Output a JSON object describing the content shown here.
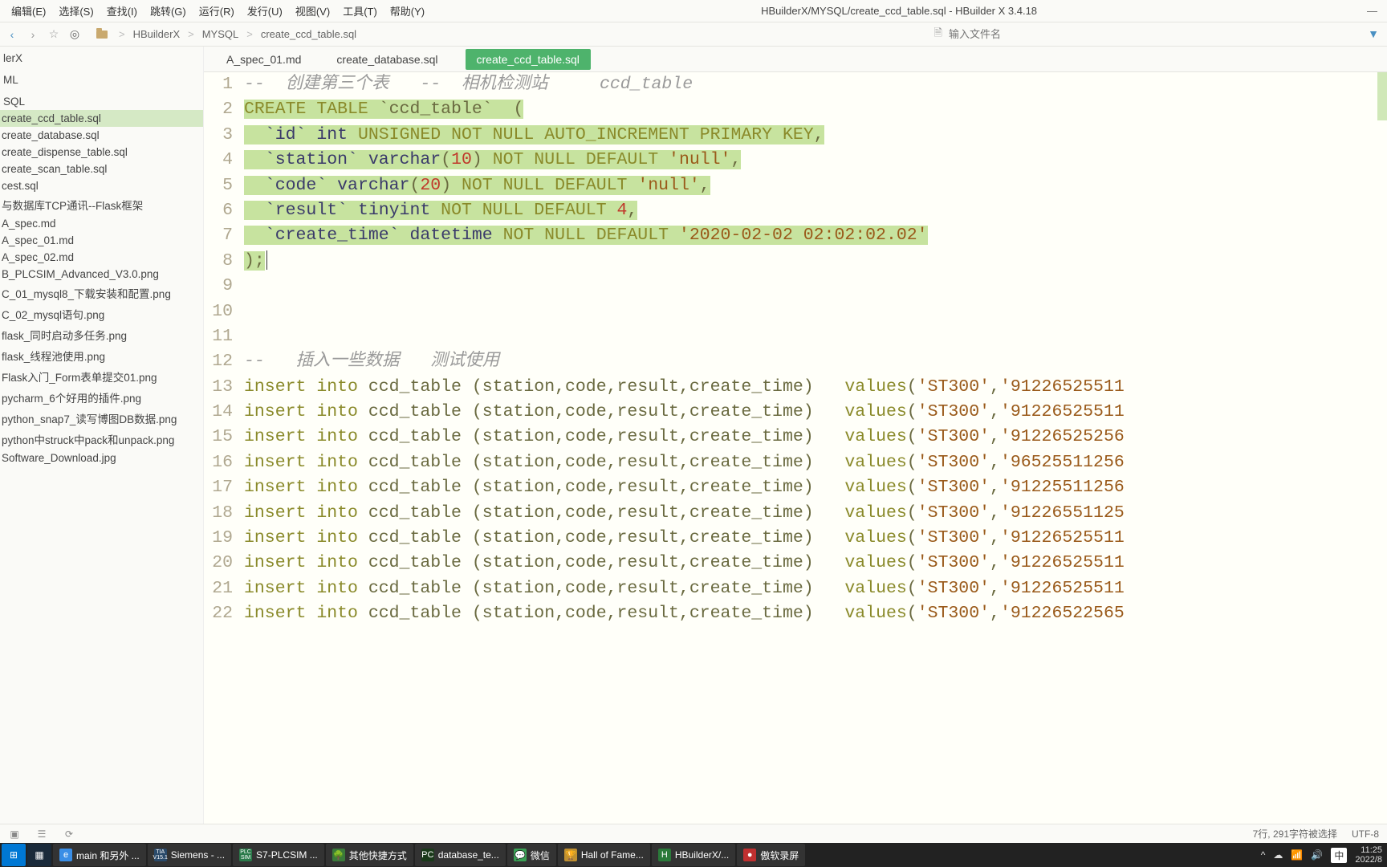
{
  "menu": [
    "编辑(E)",
    "选择(S)",
    "查找(I)",
    "跳转(G)",
    "运行(R)",
    "发行(U)",
    "视图(V)",
    "工具(T)",
    "帮助(Y)"
  ],
  "window_title": "HBuilderX/MYSQL/create_ccd_table.sql - HBuilder X 3.4.18",
  "breadcrumb": [
    "HBuilderX",
    "MYSQL",
    "create_ccd_table.sql"
  ],
  "file_input_placeholder": "输入文件名",
  "sidebar": {
    "items": [
      "lerX",
      "",
      "ML",
      "",
      "SQL",
      "create_ccd_table.sql",
      "create_database.sql",
      "create_dispense_table.sql",
      "create_scan_table.sql",
      "cest.sql",
      "与数据库TCP通讯--Flask框架",
      "A_spec.md",
      "A_spec_01.md",
      "A_spec_02.md",
      "B_PLCSIM_Advanced_V3.0.png",
      "C_01_mysql8_下载安装和配置.png",
      "C_02_mysql语句.png",
      "flask_同时启动多任务.png",
      "flask_线程池使用.png",
      "Flask入门_Form表单提交01.png",
      "pycharm_6个好用的插件.png",
      "python_snap7_读写博图DB数据.png",
      "python中struck中pack和unpack.png",
      "Software_Download.jpg"
    ],
    "active_index": 5
  },
  "tabs": [
    {
      "label": "A_spec_01.md",
      "active": false
    },
    {
      "label": "create_database.sql",
      "active": false
    },
    {
      "label": "create_ccd_table.sql",
      "active": true
    }
  ],
  "code": {
    "comment1_prefix": "-- ",
    "comment1_a": "创建第三个表",
    "comment1_b": "-- ",
    "comment1_c": "相机检测站",
    "comment1_d": "ccd_table",
    "create_kw": "CREATE TABLE",
    "table_name": "`ccd_table`",
    "open_paren": "(",
    "col_id": "`id`",
    "col_id_type": "int",
    "col_id_mods": "UNSIGNED NOT NULL AUTO_INCREMENT PRIMARY KEY",
    "col_station": "`station`",
    "col_station_type": "varchar",
    "col_station_len": "10",
    "col_station_mods": "NOT NULL DEFAULT",
    "null_str": "'null'",
    "col_code": "`code`",
    "col_code_type": "varchar",
    "col_code_len": "20",
    "col_result": "`result`",
    "col_result_type": "tinyint",
    "col_result_mods": "NOT NULL DEFAULT",
    "col_result_default": "4",
    "col_ct": "`create_time`",
    "col_ct_type": "datetime",
    "col_ct_mods": "NOT NULL DEFAULT",
    "col_ct_default": "'2020-02-02 02:02:02.02'",
    "close": ");",
    "comment2_prefix": "-- ",
    "comment2_a": "插入一些数据",
    "comment2_b": "测试使用",
    "ins_kw1": "insert",
    "ins_kw2": "into",
    "ins_tbl": "ccd_table",
    "ins_cols": "(station,code,result,create_time)",
    "ins_val_kw": "values",
    "ins_st": "'ST300'",
    "ins_code": [
      "'91226525511",
      "'91226525511",
      "'91226525256",
      "'96525511256",
      "'91225511256",
      "'91226551125",
      "'91226525511",
      "'91226525511",
      "'91226525511",
      "'91226522565"
    ]
  },
  "chart_data": {
    "type": "table",
    "title": "ccd_table",
    "columns": [
      "id",
      "station",
      "code",
      "result",
      "create_time"
    ],
    "column_types": [
      "int UNSIGNED AUTO_INCREMENT PRIMARY KEY",
      "varchar(10)",
      "varchar(20)",
      "tinyint",
      "datetime"
    ],
    "defaults": [
      null,
      "null",
      "null",
      4,
      "2020-02-02 02:02:02.02"
    ]
  },
  "status": {
    "sel": "7行, 291字符被选择",
    "enc": "UTF-8"
  },
  "taskbar": [
    {
      "label": "main 和另外 ...",
      "color": "#3a8ee6",
      "glyph": "e"
    },
    {
      "label": "Siemens - ...",
      "color": "#2a4a6a",
      "glyph": "TIA",
      "sub": "V15.1"
    },
    {
      "label": "S7-PLCSIM ...",
      "color": "#2a7a4a",
      "glyph": "PLC",
      "sub": "SIM"
    },
    {
      "label": "其他快捷方式",
      "color": "#3a7a3a",
      "glyph": "🌳"
    },
    {
      "label": "database_te...",
      "color": "#1a3a1a",
      "glyph": "PC"
    },
    {
      "label": "微信",
      "color": "#3aa055",
      "glyph": "💬"
    },
    {
      "label": "Hall of Fame...",
      "color": "#c09030",
      "glyph": "🏆"
    },
    {
      "label": "HBuilderX/...",
      "color": "#2a7a3a",
      "glyph": "H"
    },
    {
      "label": "傲软录屏",
      "color": "#c03030",
      "glyph": "●"
    }
  ],
  "tray": {
    "ime": "中",
    "time": "11:25",
    "date": "2022/8"
  }
}
